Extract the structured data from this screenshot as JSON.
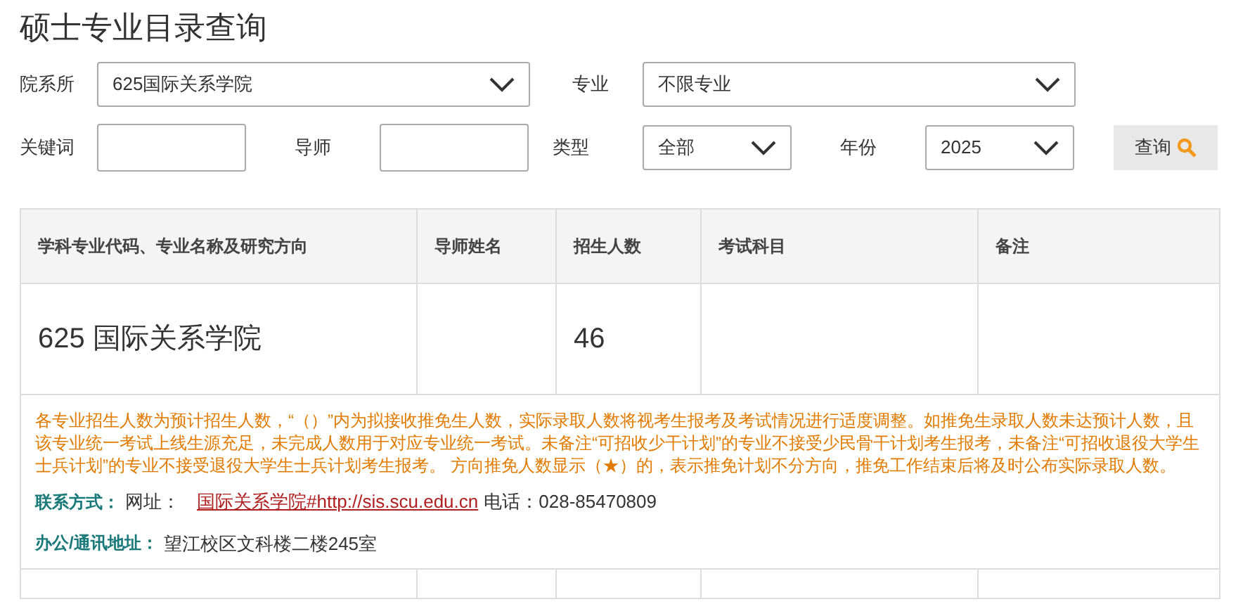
{
  "title": "硕士专业目录查询",
  "filters": [
    {
      "kind": "select",
      "label": "院系所",
      "value": "625国际关系学院"
    },
    {
      "kind": "select",
      "label": "专业",
      "value": "不限专业"
    },
    {
      "kind": "input",
      "label": "关键词"
    },
    {
      "kind": "input",
      "label": "导师"
    },
    {
      "kind": "select",
      "label": "类型",
      "value": "全部"
    },
    {
      "kind": "select",
      "label": "年份",
      "value": "2025"
    }
  ],
  "search_button": "查询",
  "table": {
    "columns": [
      "学科专业代码、专业名称及研究方向",
      "导师姓名",
      "招生人数",
      "考试科目",
      "备注"
    ],
    "rows": [
      [
        "625 国际关系学院",
        null,
        "46",
        null,
        null
      ]
    ]
  },
  "notice": "各专业招生人数为预计招生人数，“（）”内为拟接收推免生人数，实际录取人数将视考生报考及考试情况进行适度调整。如推免生录取人数未达预计人数，且该专业统一考试上线生源充足，未完成人数用于对应专业统一考试。未备注“可招收少干计划”的专业不接受少民骨干计划考生报考，未备注“可招收退役大学生士兵计划”的专业不接受退役大学生士兵计划考生报考。 方向推免人数显示（★）的，表示推免计划不分方向，推免工作结束后将及时公布实际录取人数。",
  "contact": {
    "label": "联系方式：",
    "site_label": "网址：",
    "link": "国际关系学院#http://sis.scu.edu.cn",
    "phone": "电话：028-85470809"
  },
  "address": {
    "label": "办公/通讯地址：",
    "value": "望江校区文科楼二楼245室"
  }
}
